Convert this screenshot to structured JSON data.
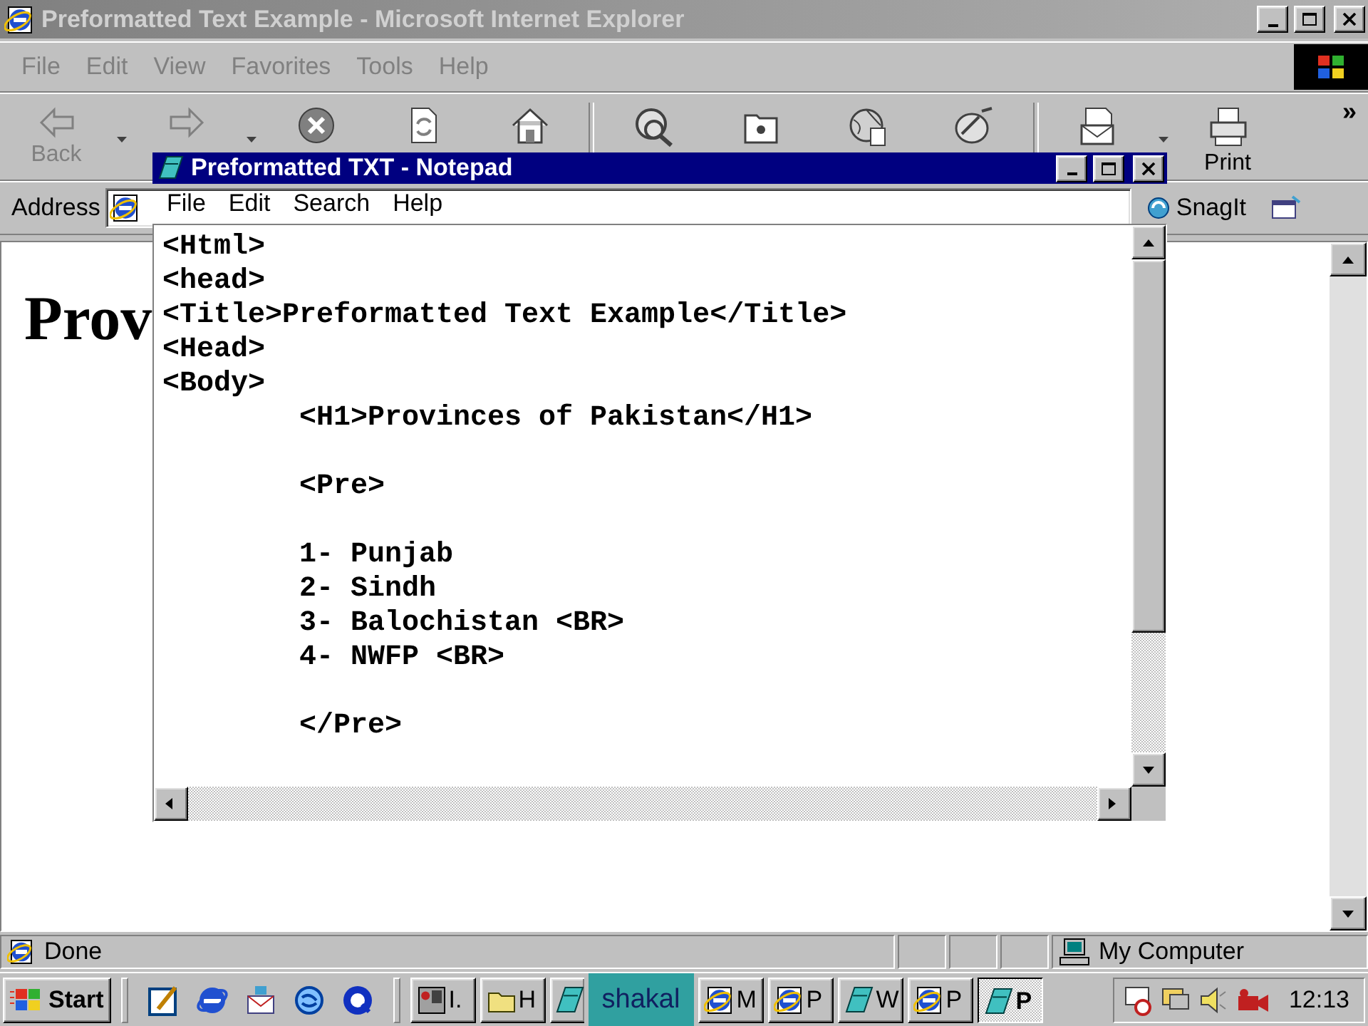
{
  "browser": {
    "title": "Preformatted Text Example - Microsoft Internet Explorer",
    "active": false,
    "menu": [
      "File",
      "Edit",
      "View",
      "Favorites",
      "Tools",
      "Help"
    ],
    "toolbar": [
      {
        "kind": "back",
        "label": "Back",
        "dropdown": true
      },
      {
        "kind": "forward",
        "dropdown": true
      },
      {
        "kind": "stop"
      },
      {
        "kind": "refresh"
      },
      {
        "kind": "home",
        "separator_after": true
      },
      {
        "kind": "search"
      },
      {
        "kind": "favorites"
      },
      {
        "kind": "history"
      },
      {
        "kind": "channels",
        "separator_after": true
      },
      {
        "kind": "mail",
        "dropdown": true
      },
      {
        "kind": "print",
        "label": "Print"
      }
    ],
    "toolbar_more": "»",
    "address_label": "Address",
    "links": [
      {
        "kind": "snagit",
        "label": "SnagIt"
      },
      {
        "kind": "capture"
      }
    ],
    "heading": "Prov",
    "status": {
      "text": "Done",
      "zone": "My Computer"
    }
  },
  "notepad": {
    "title": "Preformatted TXT - Notepad",
    "active": true,
    "menu": [
      "File",
      "Edit",
      "Search",
      "Help"
    ],
    "paragraphs": [
      [
        {
          "text": "<Html>",
          "indented": false
        },
        {
          "text": "<head>",
          "indented": false
        },
        {
          "text": "<Title>Preformatted Text Example</Title>",
          "indented": false
        },
        {
          "text": "<Head>",
          "indented": false
        },
        {
          "text": "<Body>",
          "indented": false
        },
        {
          "text": "<H1>Provinces of Pakistan</H1>",
          "indented": true
        }
      ],
      [
        {
          "text": "<Pre>",
          "indented": true
        }
      ],
      [
        {
          "text": "1- Punjab",
          "indented": true
        },
        {
          "text": "2- Sindh",
          "indented": true
        },
        {
          "text": "3- Balochistan <BR>",
          "indented": true
        },
        {
          "text": "4- NWFP <BR>",
          "indented": true
        }
      ],
      [
        {
          "text": "</Pre>",
          "indented": true
        }
      ]
    ]
  },
  "taskbar": {
    "start": "Start",
    "tasks": [
      {
        "kind": "photo",
        "label": "I.",
        "pressed": false
      },
      {
        "kind": "folder",
        "label": "H",
        "pressed": false
      },
      {
        "kind": "notepad",
        "pressed": false
      },
      {
        "kind": "banner",
        "label": "shakal"
      },
      {
        "kind": "ie",
        "label": "M",
        "pressed": false
      },
      {
        "kind": "ie",
        "label": "P",
        "pressed": false
      },
      {
        "kind": "notepad",
        "label": "W",
        "pressed": false
      },
      {
        "kind": "ie",
        "label": "P",
        "pressed": false
      },
      {
        "kind": "notepad",
        "label": "P",
        "pressed": true
      }
    ],
    "clock": "12:13"
  }
}
